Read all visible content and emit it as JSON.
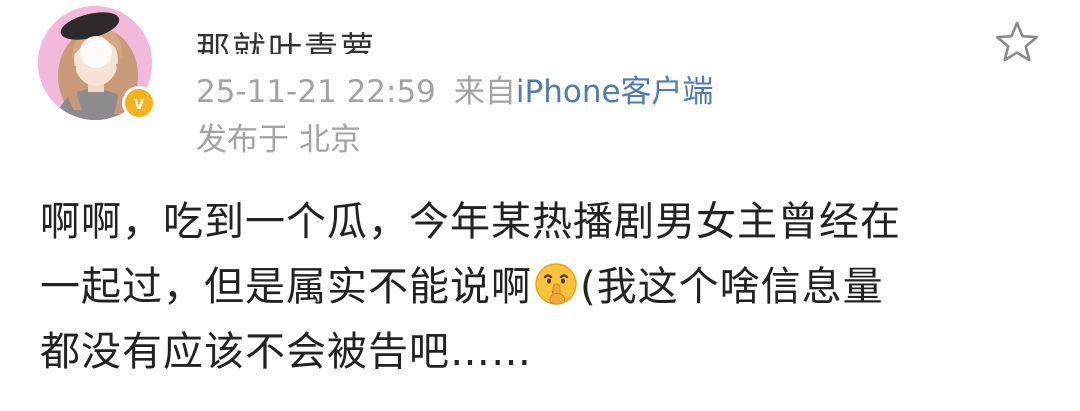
{
  "post": {
    "author": {
      "name": "那就叶青萝",
      "verified_color": "#f5b21a",
      "verified_mark": "v"
    },
    "meta": {
      "timestamp": "25-11-21 22:59",
      "source_prefix": "来自",
      "source_device": "iPhone客户端",
      "location": "发布于 北京"
    },
    "actions": {
      "favorite_icon": "star-outline"
    },
    "content": {
      "line1": "啊啊，吃到一个瓜，今年某热播剧男女主曾经在",
      "line2_before_emoji": "一起过，但是属实不能说啊",
      "emoji": "shushing-face",
      "line2_after_emoji": "(我这个啥信息量",
      "line3": "都没有应该不会被告吧……"
    }
  },
  "colors": {
    "accent_link": "#4f7bb5",
    "meta_gray": "#a3a3a3",
    "text": "#222222"
  }
}
